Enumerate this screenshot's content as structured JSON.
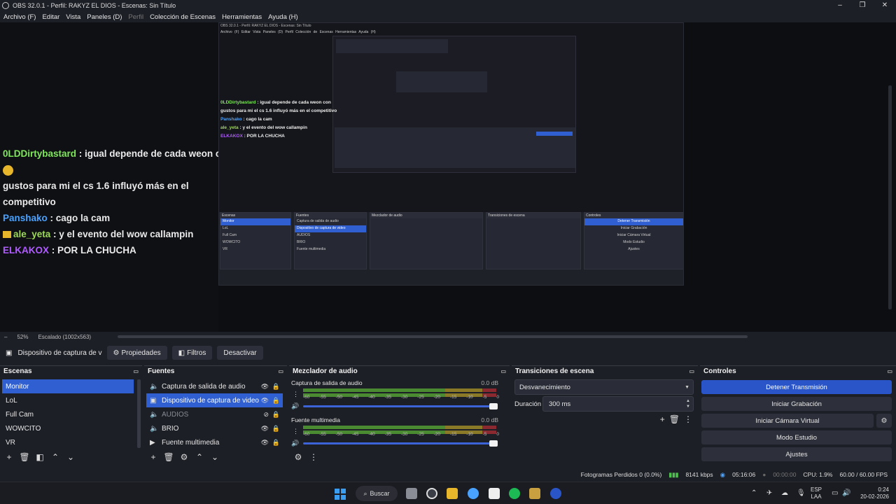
{
  "window": {
    "title": "OBS 32.0.1 - Perfil: RAKYZ EL DIOS - Escenas: Sin Título",
    "controls": [
      "–",
      "❐",
      "✕"
    ]
  },
  "menu": [
    "Archivo (F)",
    "Editar",
    "Vista",
    "Paneles (D)",
    "Perfil",
    "Colección de Escenas",
    "Herramientas",
    "Ayuda (H)"
  ],
  "chat": [
    {
      "user": "0LDDirtybastard",
      "text": " : igual depende de cada weon con ",
      "cont": "gustos para mi el cs 1.6 influyó más en el competitivo"
    },
    {
      "user": "Panshako",
      "text": " : cago la cam"
    },
    {
      "user": "ale_yeta",
      "text": " : y el evento del wow callampin"
    },
    {
      "user": "ELKAKOX",
      "text": " : POR LA CHUCHA"
    }
  ],
  "nested": {
    "title": "OBS 32.0.1 - Perfil: RAKYZ EL DIOS - Escenas: Sin Título",
    "menu": "Archivo (F)  Editar  Vista  Paneles (D)  Perfil  Colección de Escenas  Herramientas  Ayuda (H)",
    "scenes_header": "Escenas",
    "sources_header": "Fuentes",
    "mixer_header": "Mezclador de audio",
    "trans_header": "Transiciones de escena",
    "controls_header": "Controles",
    "scenes": [
      "Monitor",
      "LoL",
      "Full Cam",
      "WOWCITO",
      "VR"
    ],
    "sources": [
      "Captura de salida de audio",
      "Dispositivo de captura de video",
      "AUDIOS",
      "BRIO",
      "Fuente multimedia"
    ],
    "controls": [
      "Detener Transmisión",
      "Iniciar Grabación",
      "Iniciar Cámara Virtual",
      "Modo Estudio",
      "Ajustes"
    ]
  },
  "zoom": {
    "percent": "52%",
    "scaled": "Escalado (1002x563)"
  },
  "source_toolbar": {
    "selected_source": "Dispositivo de captura de v",
    "properties": "Propiedades",
    "filters": "Filtros",
    "deactivate": "Desactivar"
  },
  "scenes": {
    "header": "Escenas",
    "items": [
      "Monitor",
      "LoL",
      "Full Cam",
      "WOWCITO",
      "VR"
    ],
    "selected": 0
  },
  "sources": {
    "header": "Fuentes",
    "items": [
      {
        "label": "Captura de salida de audio",
        "icon": "speaker-icon",
        "visible": true
      },
      {
        "label": "Dispositivo de captura de video",
        "icon": "camera-icon",
        "visible": true,
        "selected": true
      },
      {
        "label": "AUDIOS",
        "icon": "speaker-icon",
        "visible": false
      },
      {
        "label": "BRIO",
        "icon": "speaker-icon",
        "visible": true
      },
      {
        "label": "Fuente multimedia",
        "icon": "play-icon",
        "visible": true
      }
    ]
  },
  "mixer": {
    "header": "Mezclador de audio",
    "channels": [
      {
        "name": "Captura de salida de audio",
        "db": "0.0 dB"
      },
      {
        "name": "Fuente multimedia",
        "db": "0.0 dB"
      }
    ],
    "ticks": [
      "-60",
      "-55",
      "-50",
      "-45",
      "-40",
      "-35",
      "-30",
      "-25",
      "-20",
      "-15",
      "-10",
      "-5",
      "0"
    ]
  },
  "transitions": {
    "header": "Transiciones de escena",
    "selected": "Desvanecimiento",
    "duration_label": "Duración",
    "duration_value": "300 ms"
  },
  "controls": {
    "header": "Controles",
    "stop_stream": "Detener Transmisión",
    "start_recording": "Iniciar Grabación",
    "start_virtual_cam": "Iniciar Cámara Virtual",
    "studio_mode": "Modo Estudio",
    "settings": "Ajustes"
  },
  "status": {
    "dropped": "Fotogramas Perdidos 0 (0.0%)",
    "bitrate": "8141 kbps",
    "stream_time": "05:16:06",
    "rec_time": "00:00:00",
    "cpu": "CPU: 1.9%",
    "fps": "60.00 / 60.00 FPS"
  },
  "taskbar": {
    "search": "Buscar",
    "lang": "ESP",
    "lang2": "LAA",
    "time": "0:24",
    "date": "20-02-2026"
  },
  "colors": {
    "accent": "#2f5fd0",
    "background": "#1d1f26",
    "panel": "#2d2f3a"
  }
}
